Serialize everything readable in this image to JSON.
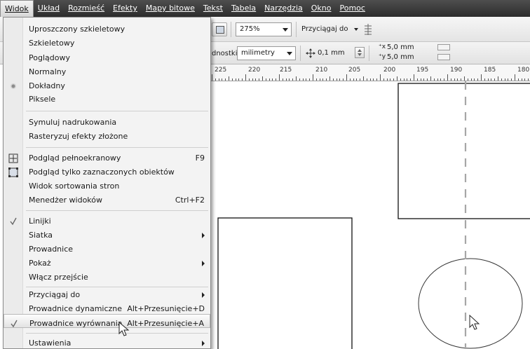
{
  "menubar": {
    "items": [
      "Widok",
      "Układ",
      "Rozmieść",
      "Efekty",
      "Mapy bitowe",
      "Tekst",
      "Tabela",
      "Narzędzia",
      "Okno",
      "Pomoc"
    ],
    "active": "Widok"
  },
  "toolbar": {
    "zoom_value": "275%",
    "snap_label": "Przyciągaj do",
    "units_label": "dnostki:",
    "units_value": "milimetry",
    "nudge_value": "0,1 mm",
    "dup_x_value": "5,0 mm",
    "dup_y_value": "5,0 mm"
  },
  "ruler": {
    "labels": [
      "225",
      "220",
      "215",
      "210",
      "205",
      "200",
      "195",
      "190",
      "185",
      "180"
    ]
  },
  "view_menu": {
    "items": [
      {
        "label": "Uproszczony szkieletowy",
        "shortcut": "",
        "icon": "",
        "submenu": false
      },
      {
        "label": "Szkieletowy",
        "shortcut": "",
        "icon": "",
        "submenu": false
      },
      {
        "label": "Poglądowy",
        "shortcut": "",
        "icon": "",
        "submenu": false
      },
      {
        "label": "Normalny",
        "shortcut": "",
        "icon": "",
        "submenu": false
      },
      {
        "label": "Dokładny",
        "shortcut": "",
        "icon": "radio-bullet-icon",
        "submenu": false
      },
      {
        "label": "Piksele",
        "shortcut": "",
        "icon": "",
        "submenu": false
      },
      {
        "label": "Symuluj nadrukowania",
        "shortcut": "",
        "icon": "",
        "submenu": false
      },
      {
        "label": "Rasteryzuj efekty złożone",
        "shortcut": "",
        "icon": "",
        "submenu": false
      },
      {
        "label": "Podgląd pełnoekranowy",
        "shortcut": "F9",
        "icon": "fullscreen-preview-icon",
        "submenu": false
      },
      {
        "label": "Podgląd tylko zaznaczonych obiektów",
        "shortcut": "",
        "icon": "selected-preview-icon",
        "submenu": false
      },
      {
        "label": "Widok sortowania stron",
        "shortcut": "",
        "icon": "",
        "submenu": false
      },
      {
        "label": "Menedżer widoków",
        "shortcut": "Ctrl+F2",
        "icon": "",
        "submenu": false
      },
      {
        "label": "Linijki",
        "shortcut": "",
        "icon": "check-icon",
        "submenu": false
      },
      {
        "label": "Siatka",
        "shortcut": "",
        "icon": "",
        "submenu": true
      },
      {
        "label": "Prowadnice",
        "shortcut": "",
        "icon": "",
        "submenu": false
      },
      {
        "label": "Pokaż",
        "shortcut": "",
        "icon": "",
        "submenu": true
      },
      {
        "label": "Włącz przejście",
        "shortcut": "",
        "icon": "",
        "submenu": false
      },
      {
        "label": "Przyciągaj do",
        "shortcut": "",
        "icon": "",
        "submenu": true
      },
      {
        "label": "Prowadnice dynamiczne",
        "shortcut": "Alt+Przesunięcie+D",
        "icon": "",
        "submenu": false
      },
      {
        "label": "Prowadnice wyrównania",
        "shortcut": "Alt+Przesunięcie+A",
        "icon": "check-icon",
        "submenu": false
      },
      {
        "label": "Ustawienia",
        "shortcut": "",
        "icon": "",
        "submenu": true
      }
    ],
    "highlighted": "Prowadnice wyrównania"
  },
  "colors": {
    "menubar_bg": "#3a3a3a",
    "menu_bg": "#f3f3f3",
    "guide": "#a6a6a6"
  }
}
